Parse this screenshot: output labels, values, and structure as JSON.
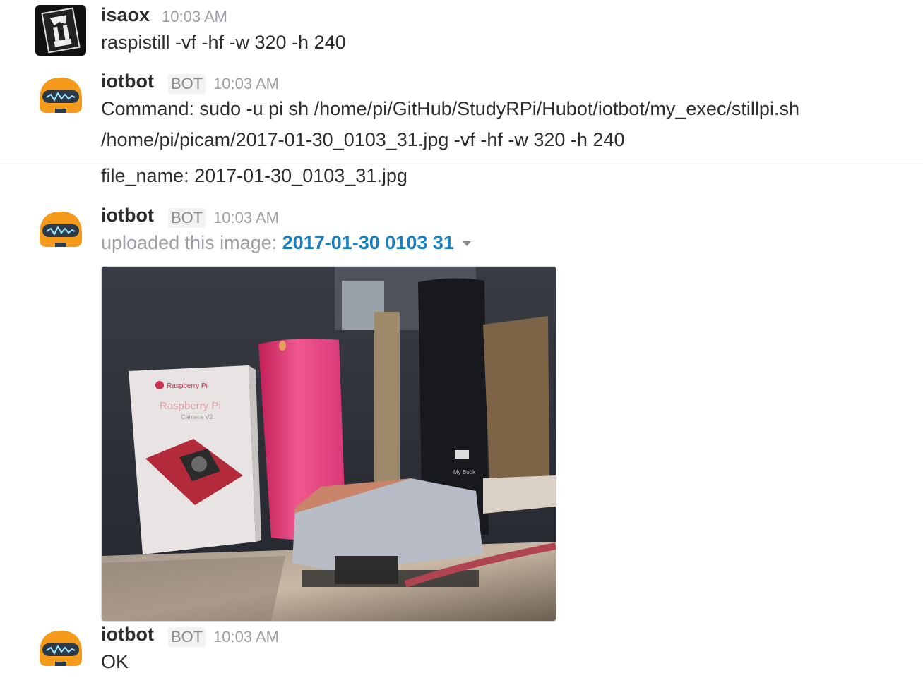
{
  "messages": [
    {
      "author": "isaox",
      "time": "10:03 AM",
      "text": "raspistill -vf -hf -w 320 -h 240"
    },
    {
      "author": "iotbot",
      "badge": "BOT",
      "time": "10:03 AM",
      "lines": [
        "Command: sudo -u pi sh /home/pi/GitHub/StudyRPi/Hubot/iotbot/my_exec/stillpi.sh",
        "/home/pi/picam/2017-01-30_0103_31.jpg  -vf -hf -w 320 -h 240"
      ],
      "continuation": "file_name: 2017-01-30_0103_31.jpg"
    },
    {
      "author": "iotbot",
      "badge": "BOT",
      "time": "10:03 AM",
      "upload_prefix": "uploaded this image: ",
      "file_title": "2017-01-30 0103 31",
      "photo_box_brand": "Raspberry Pi",
      "photo_box_title": "Raspberry Pi",
      "photo_box_subtitle": "Camera V2",
      "photo_drive_label": "My Book"
    },
    {
      "author": "iotbot",
      "badge": "BOT",
      "time": "10:03 AM",
      "text": "OK"
    }
  ],
  "colors": {
    "link": "#1a7fbf",
    "new_message_divider": "#f0b68c",
    "bot_avatar": "#f59a1b"
  }
}
